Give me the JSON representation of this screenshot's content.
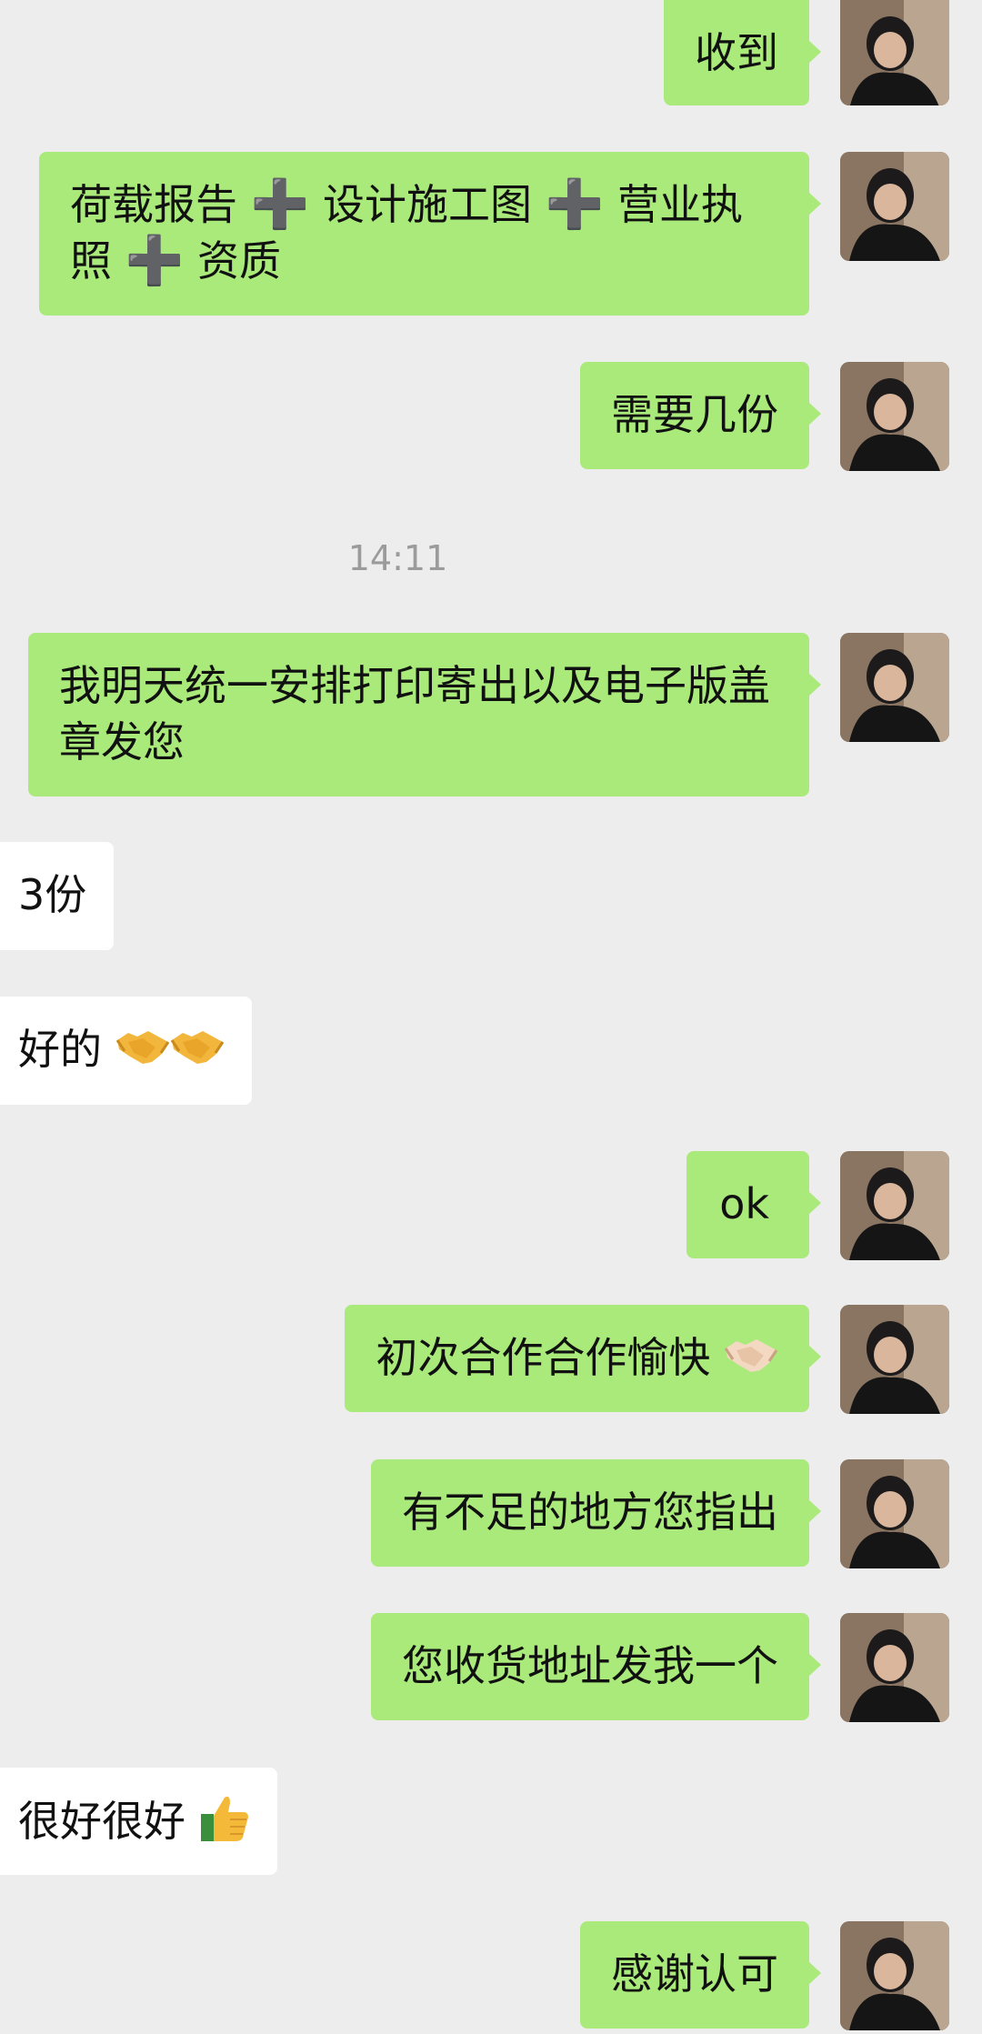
{
  "conversation": {
    "timestamp": "14:11",
    "messages": [
      {
        "id": "m1",
        "side": "out",
        "text": "收到"
      },
      {
        "id": "m2",
        "side": "out",
        "parts": [
          "荷载报告",
          "设计施工图",
          "营业执照",
          "资质"
        ],
        "separator": "➕"
      },
      {
        "id": "m3",
        "side": "out",
        "text": "需要几份"
      },
      {
        "id": "m4",
        "side": "out",
        "text": "我明天统一安排打印寄出以及电子版盖章发您"
      },
      {
        "id": "m5",
        "side": "in",
        "text": "3份"
      },
      {
        "id": "m6",
        "side": "in",
        "text": "好的",
        "emoji": [
          "handshake-icon",
          "handshake-icon"
        ]
      },
      {
        "id": "m7",
        "side": "out",
        "text": "ok"
      },
      {
        "id": "m8",
        "side": "out",
        "text": "初次合作合作愉快",
        "emoji": [
          "handshake-icon"
        ]
      },
      {
        "id": "m9",
        "side": "out",
        "text": "有不足的地方您指出"
      },
      {
        "id": "m10",
        "side": "out",
        "text": "您收货地址发我一个"
      },
      {
        "id": "m11",
        "side": "in",
        "text": "很好很好",
        "emoji": [
          "thumbs-up-icon"
        ]
      },
      {
        "id": "m12",
        "side": "out",
        "text": "感谢认可"
      }
    ]
  },
  "colors": {
    "background": "#ededed",
    "outgoing_bubble": "#a9ea7a",
    "incoming_bubble": "#ffffff",
    "timestamp_text": "#9b9b9b"
  }
}
